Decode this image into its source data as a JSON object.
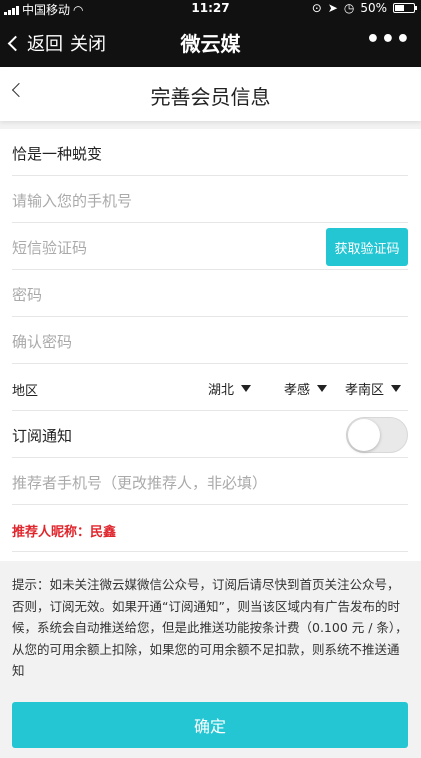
{
  "status_bar": {
    "carrier": "中国移动",
    "time": "11:27",
    "battery_text": "50%",
    "battery_level": 0.5
  },
  "wechat_nav": {
    "back_label": "返回",
    "close_label": "关闭",
    "title": "微云媒",
    "more_label": "•••"
  },
  "page_header": {
    "back_label": "<",
    "title": "完善会员信息"
  },
  "form": {
    "nickname": "恰是一种蜕变",
    "phone_placeholder": "请输入您的手机号",
    "sms_placeholder": "短信验证码",
    "get_code_label": "获取验证码",
    "password_placeholder": "密码",
    "confirm_password_placeholder": "确认密码",
    "region_label": "地区",
    "region_province": "湖北",
    "region_city": "孝感",
    "region_district": "孝南区",
    "subscribe_label": "订阅通知",
    "subscribe_on": false,
    "referrer_placeholder": "推荐者手机号（更改推荐人，非必填）",
    "referrer_nickname_line": "推荐人昵称：民鑫"
  },
  "notice": "提示：如未关注微云媒微信公众号，订阅后请尽快到首页关注公众号，否则，订阅无效。如果开通“订阅通知”，则当该区域内有广告发布的时候，系统会自动推送给您，但是此推送功能按条计费（0.100 元 / 条），从您的可用余额上扣除，如果您的可用余额不足扣款，则系统不推送通知",
  "confirm_label": "确定",
  "colors": {
    "accent": "#25c6d4",
    "referrer_text": "#e0262d",
    "nav_bg": "#111111"
  }
}
